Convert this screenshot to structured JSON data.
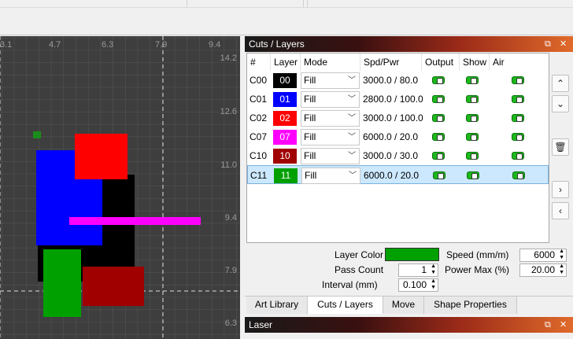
{
  "canvas": {
    "ruler_top": [
      "4.7",
      "6.3",
      "7.9",
      "9.4"
    ],
    "ruler_top_partial": "3.1",
    "ruler_right": [
      "14.2",
      "12.6",
      "11.0",
      "9.4",
      "7.9",
      "6.3"
    ]
  },
  "cuts_panel": {
    "title": "Cuts / Layers",
    "columns": [
      "#",
      "Layer",
      "Mode",
      "Spd/Pwr",
      "Output",
      "Show",
      "Air"
    ],
    "rows": [
      {
        "id": "C00",
        "layer": "00",
        "color": "#000000",
        "mode": "Fill",
        "spdpwr": "3000.0 / 80.0"
      },
      {
        "id": "C01",
        "layer": "01",
        "color": "#0000ff",
        "mode": "Fill",
        "spdpwr": "2800.0 / 100.0"
      },
      {
        "id": "C02",
        "layer": "02",
        "color": "#ff0000",
        "mode": "Fill",
        "spdpwr": "3000.0 / 100.0"
      },
      {
        "id": "C07",
        "layer": "07",
        "color": "#ff00ff",
        "mode": "Fill",
        "spdpwr": "6000.0 / 20.0"
      },
      {
        "id": "C10",
        "layer": "10",
        "color": "#a00000",
        "mode": "Fill",
        "spdpwr": "3000.0 / 30.0"
      },
      {
        "id": "C11",
        "layer": "11",
        "color": "#00a000",
        "mode": "Fill",
        "spdpwr": "6000.0 / 20.0"
      }
    ],
    "selected_row": "C11"
  },
  "properties": {
    "layer_color_label": "Layer Color",
    "layer_color": "#00a000",
    "pass_count_label": "Pass Count",
    "pass_count": "1",
    "interval_label": "Interval (mm)",
    "interval": "0.100",
    "speed_label": "Speed (mm/m)",
    "speed": "6000",
    "power_max_label": "Power Max (%)",
    "power_max": "20.00"
  },
  "tabs": [
    "Art Library",
    "Cuts / Layers",
    "Move",
    "Shape Properties"
  ],
  "active_tab": "Cuts / Layers",
  "laser_panel": {
    "title": "Laser"
  }
}
